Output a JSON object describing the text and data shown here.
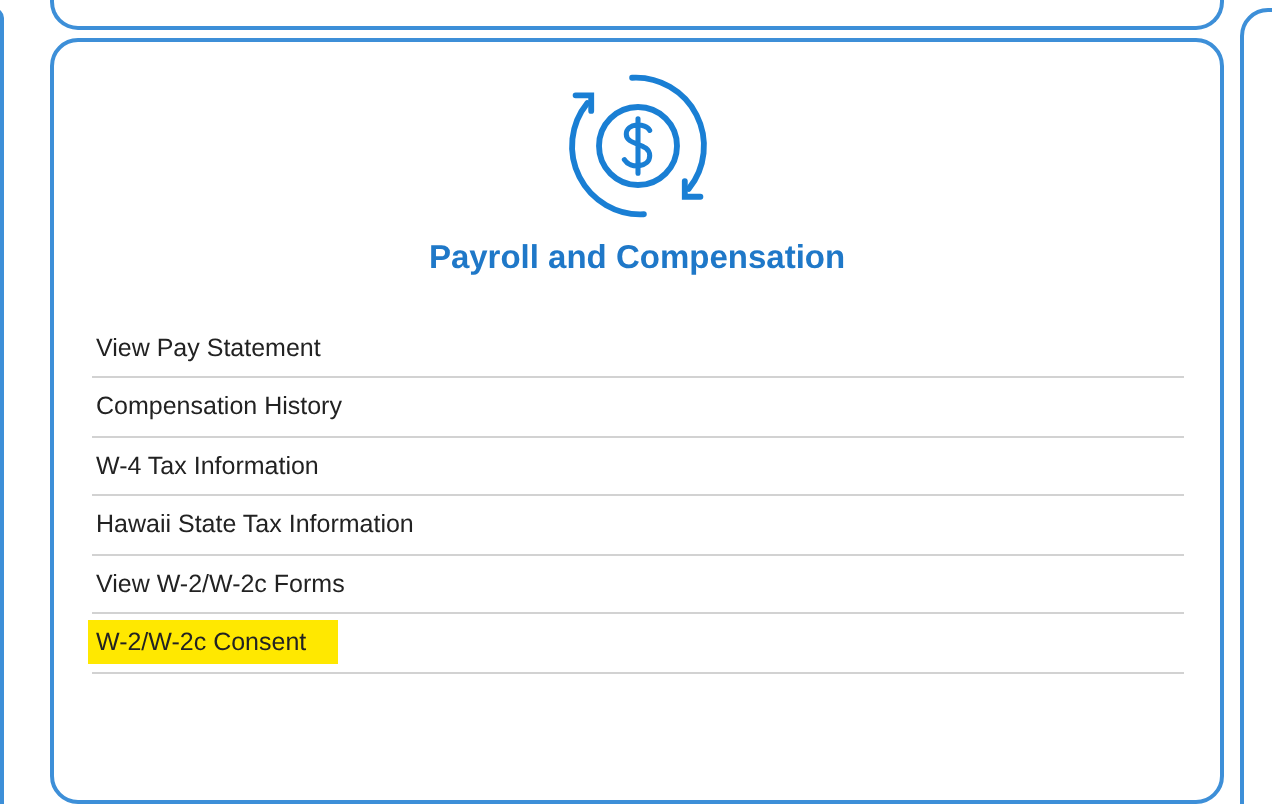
{
  "card": {
    "title": "Payroll and Compensation",
    "links": [
      {
        "label": "View Pay Statement",
        "highlighted": false
      },
      {
        "label": "Compensation History",
        "highlighted": false
      },
      {
        "label": "W-4 Tax Information",
        "highlighted": false
      },
      {
        "label": "Hawaii State Tax Information",
        "highlighted": false
      },
      {
        "label": "View W-2/W-2c Forms",
        "highlighted": false
      },
      {
        "label": "W-2/W-2c Consent",
        "highlighted": true
      }
    ]
  }
}
